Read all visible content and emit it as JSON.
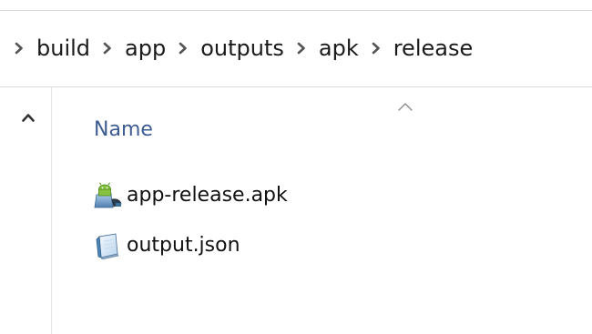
{
  "breadcrumb": {
    "items": [
      "build",
      "app",
      "outputs",
      "apk",
      "release"
    ]
  },
  "file_list": {
    "column_header": "Name",
    "sort": "ascending",
    "files": [
      {
        "name": "app-release.apk",
        "icon": "android-apk-icon"
      },
      {
        "name": "output.json",
        "icon": "json-file-icon"
      }
    ]
  },
  "colors": {
    "header_text": "#3d5c91",
    "separator": "#d9d9d9",
    "chevron": "#7a7a7a"
  }
}
